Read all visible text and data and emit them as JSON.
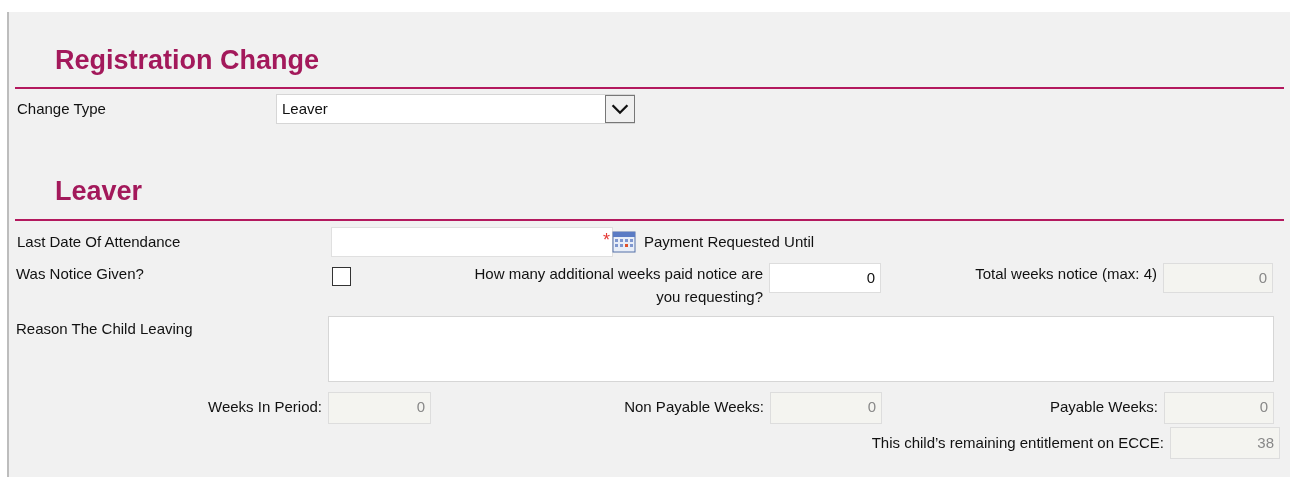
{
  "registration_change": {
    "heading": "Registration Change",
    "change_type": {
      "label": "Change Type",
      "value": "Leaver"
    }
  },
  "leaver": {
    "heading": "Leaver",
    "last_date": {
      "label": "Last Date Of Attendance",
      "required_mark": "*"
    },
    "payment_requested_until": {
      "label": "Payment Requested Until"
    },
    "notice_given": {
      "label": "Was Notice Given?",
      "checked": false
    },
    "additional_weeks": {
      "label": "How many additional weeks paid notice are you requesting?",
      "value": "0",
      "disabled": false
    },
    "total_weeks": {
      "label": "Total weeks notice (max: 4)",
      "value": "0",
      "disabled": true
    },
    "reason": {
      "label": "Reason The Child Leaving"
    },
    "weeks_in_period": {
      "label": "Weeks In Period:",
      "value": "0",
      "disabled": true
    },
    "non_payable_weeks": {
      "label": "Non Payable Weeks:",
      "value": "0",
      "disabled": true
    },
    "payable_weeks": {
      "label": "Payable Weeks:",
      "value": "0",
      "disabled": true
    },
    "remaining_entitlement": {
      "label": "This child’s remaining entitlement on ECCE:",
      "value": "38",
      "disabled": true
    }
  }
}
